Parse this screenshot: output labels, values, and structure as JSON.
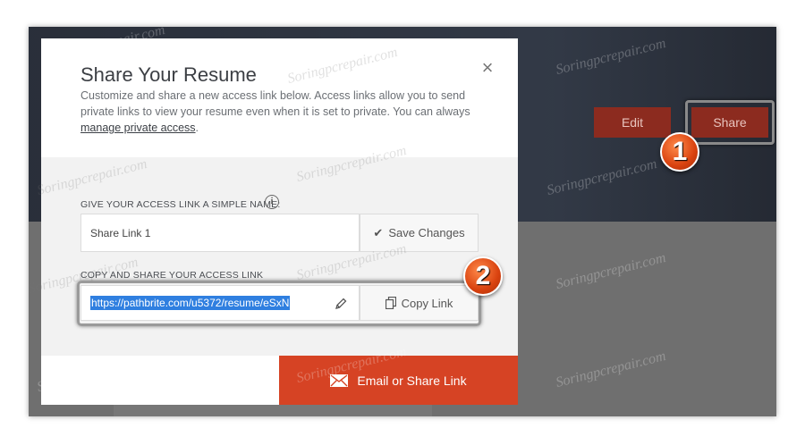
{
  "background": {
    "header_buttons": {
      "edit": "Edit",
      "share": "Share"
    }
  },
  "modal": {
    "title": "Share Your Resume",
    "description_before_link": "Customize and share a new access link below. Access links allow you to send private links to view your resume even when it is set to private. You can always ",
    "description_link": "manage private access",
    "description_after_link": ".",
    "name_label": "GIVE YOUR ACCESS LINK A SIMPLE NAME:",
    "name_value": "Share Link 1",
    "save_label": "Save Changes",
    "link_label": "COPY AND SHARE YOUR ACCESS LINK",
    "link_value": "https://pathbrite.com/u5372/resume/eSxN",
    "copy_label": "Copy Link",
    "email_label": "Email or Share Link"
  },
  "annotations": {
    "badge1": "1",
    "badge2": "2"
  },
  "watermark": "Soringpcrepair.com",
  "colors": {
    "accent": "#d64324",
    "header_button": "#8c2b1f",
    "selection": "#2f7fe0"
  }
}
